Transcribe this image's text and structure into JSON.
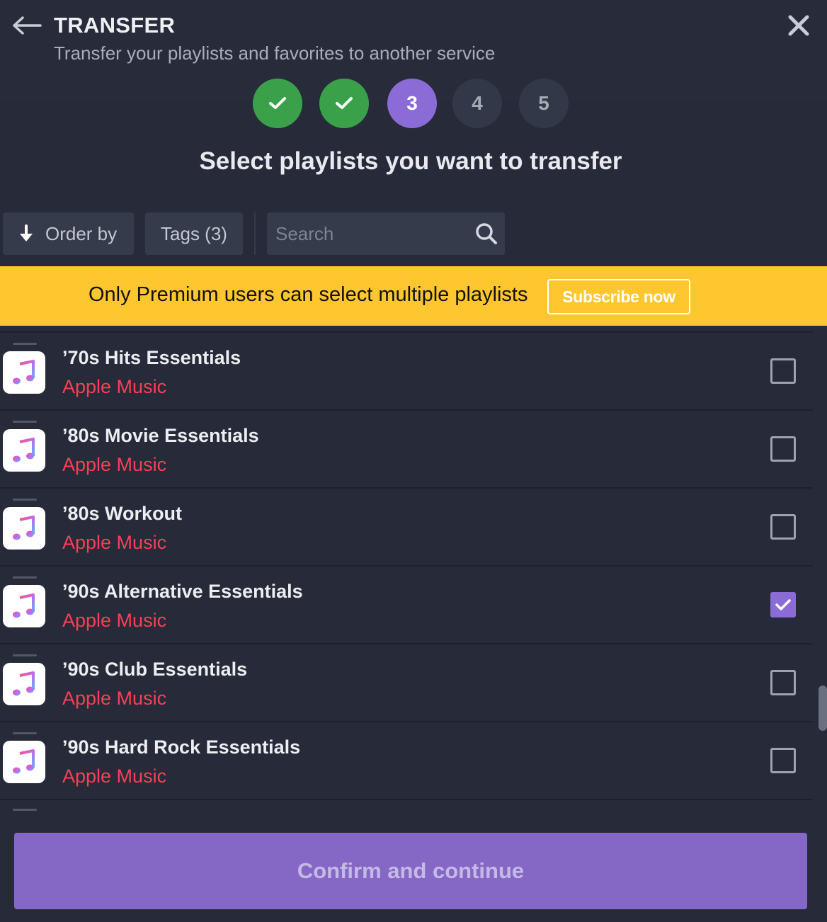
{
  "header": {
    "title": "TRANSFER",
    "subtitle": "Transfer your playlists and favorites to another service"
  },
  "steps": [
    {
      "label": "",
      "state": "done"
    },
    {
      "label": "",
      "state": "done"
    },
    {
      "label": "3",
      "state": "active"
    },
    {
      "label": "4",
      "state": "pending"
    },
    {
      "label": "5",
      "state": "pending"
    }
  ],
  "heading": "Select playlists you want to transfer",
  "toolbar": {
    "order_label": "Order by",
    "tags_label": "Tags (3)",
    "search_placeholder": "Search",
    "search_value": ""
  },
  "banner": {
    "text": "Only Premium users can select multiple playlists",
    "button": "Subscribe now"
  },
  "playlists": [
    {
      "name": "’70s Hits Essentials",
      "source": "Apple Music",
      "checked": false
    },
    {
      "name": "’80s Movie Essentials",
      "source": "Apple Music",
      "checked": false
    },
    {
      "name": "’80s Workout",
      "source": "Apple Music",
      "checked": false
    },
    {
      "name": "’90s Alternative Essentials",
      "source": "Apple Music",
      "checked": true
    },
    {
      "name": "’90s Club Essentials",
      "source": "Apple Music",
      "checked": false
    },
    {
      "name": "’90s Hard Rock Essentials",
      "source": "Apple Music",
      "checked": false
    }
  ],
  "confirm_label": "Confirm and continue",
  "colors": {
    "background": "#262a39",
    "accent": "#8b6cd6",
    "done": "#3aa14a",
    "banner": "#ffc72f",
    "source": "#fa3f55"
  }
}
